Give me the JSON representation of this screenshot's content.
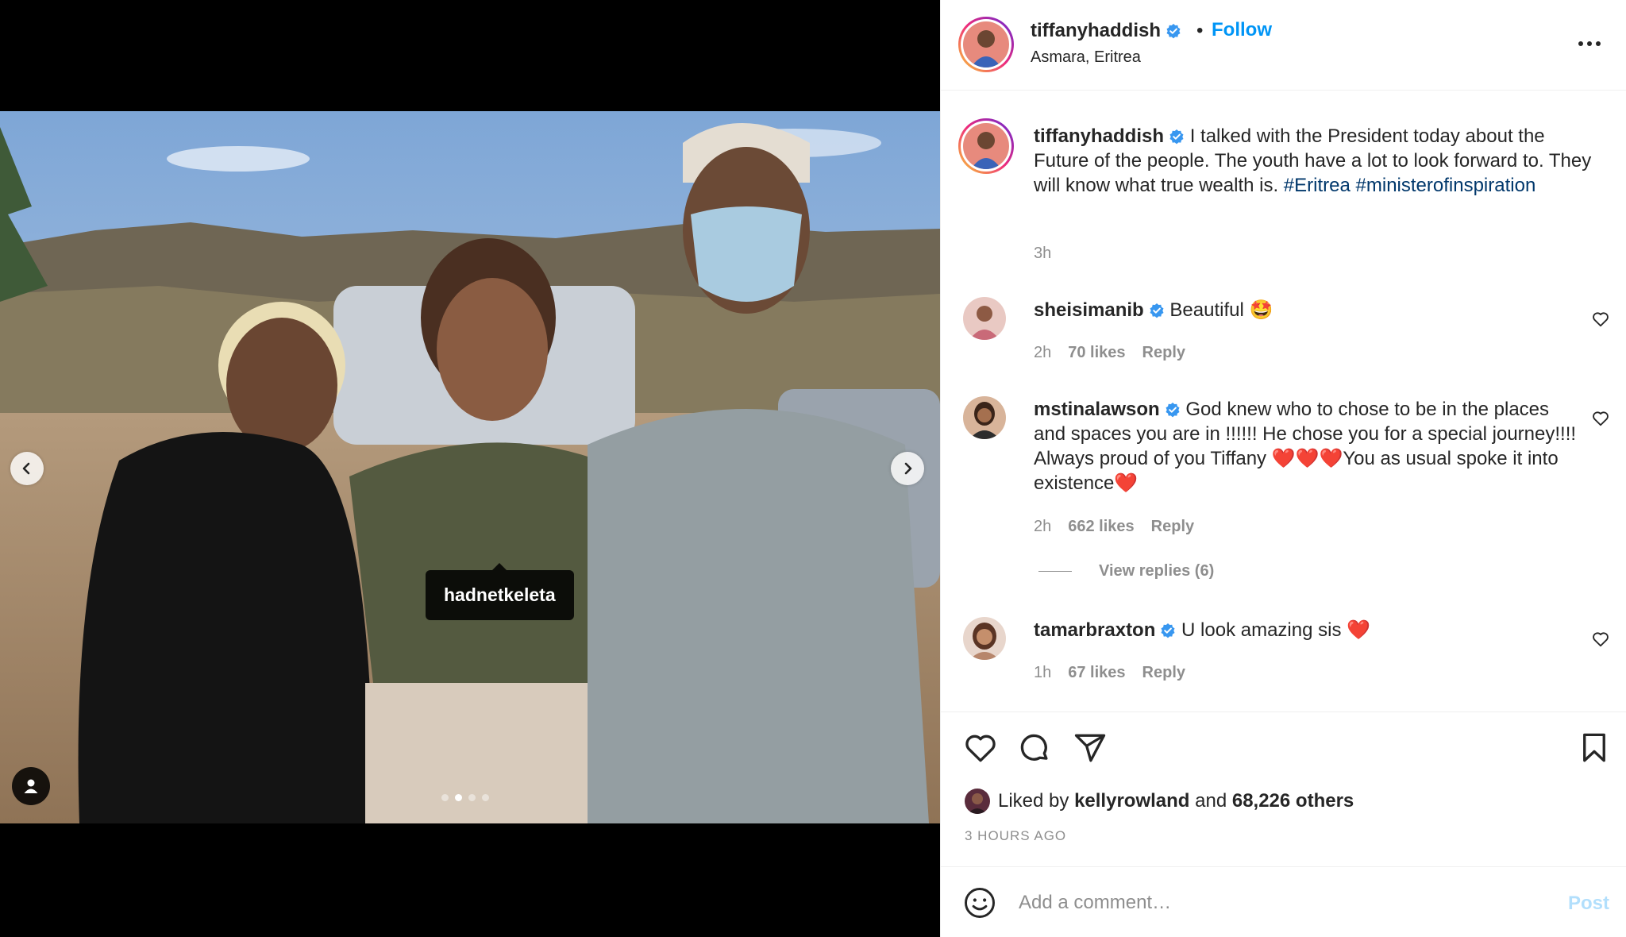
{
  "post": {
    "username": "tiffanyhaddish",
    "follow_label": "Follow",
    "separator": "•",
    "location": "Asmara, Eritrea",
    "more_icon": "more-horizontal-icon",
    "photo_tag": "hadnetkeleta",
    "carousel": {
      "count": 4,
      "active_index": 1
    }
  },
  "caption": {
    "username": "tiffanyhaddish",
    "text": "I talked with the President today about the Future of the people. The youth have a lot to look forward to. They will know what true wealth is. ",
    "hashtags": [
      "#Eritrea",
      "#ministerofinspiration"
    ],
    "time": "3h"
  },
  "comments": [
    {
      "username": "sheisimanib",
      "text": "Beautiful 🤩",
      "time": "2h",
      "likes": "70 likes",
      "reply_label": "Reply"
    },
    {
      "username": "mstinalawson",
      "text": "God knew who to chose to be in the places and spaces you are in !!!!!! He chose you for a special journey!!!! Always proud of you Tiffany ❤️❤️❤️You as usual spoke it into existence❤️",
      "time": "2h",
      "likes": "662 likes",
      "reply_label": "Reply",
      "view_replies": "View replies (6)"
    },
    {
      "username": "tamarbraxton",
      "text": "U look amazing sis ❤️",
      "time": "1h",
      "likes": "67 likes",
      "reply_label": "Reply"
    }
  ],
  "likes": {
    "prefix": "Liked by",
    "first_user": "kellyrowland",
    "middle": "and",
    "others": "68,226 others"
  },
  "timestamp": "3 HOURS AGO",
  "comment_box": {
    "placeholder": "Add a comment…",
    "post_label": "Post"
  },
  "colors": {
    "link_blue": "#0095f6",
    "hashtag_blue": "#00376b",
    "post_disabled": "#b2dffc",
    "meta_gray": "#8e8e8e",
    "verified_blue": "#3897f0"
  }
}
